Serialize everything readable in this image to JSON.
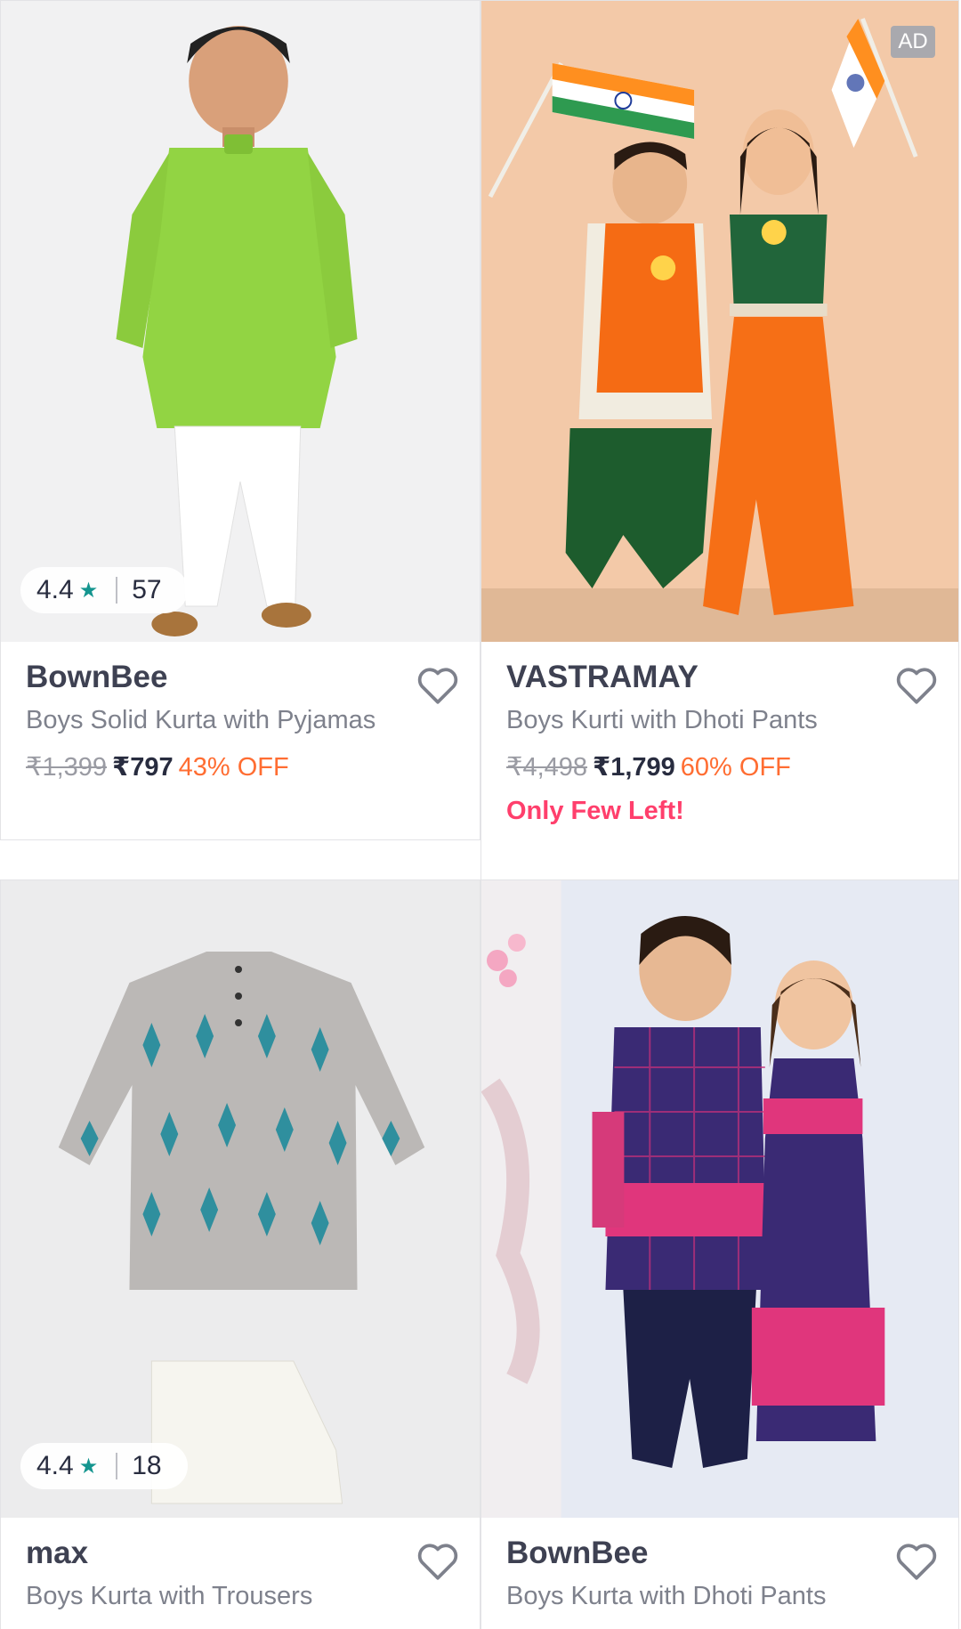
{
  "ad_label": "AD",
  "products": [
    {
      "brand": "BownBee",
      "name": "Boys Solid Kurta with Pyjamas",
      "mrp": "₹1,399",
      "price": "₹797",
      "discount": "43% OFF",
      "rating": "4.4",
      "rating_count": "57"
    },
    {
      "brand": "VASTRAMAY",
      "name": "Boys Kurti with Dhoti Pants",
      "mrp": "₹4,498",
      "price": "₹1,799",
      "discount": "60% OFF",
      "stock_note": "Only Few Left!"
    },
    {
      "brand": "max",
      "name": "Boys Kurta with Trousers",
      "rating": "4.4",
      "rating_count": "18"
    },
    {
      "brand": "BownBee",
      "name": "Boys Kurta with Dhoti Pants"
    }
  ],
  "colors": {
    "rating_star": "#14958f",
    "discount": "#ff6d32",
    "stock_note": "#ff3f6c",
    "brand": "#3e4152"
  }
}
